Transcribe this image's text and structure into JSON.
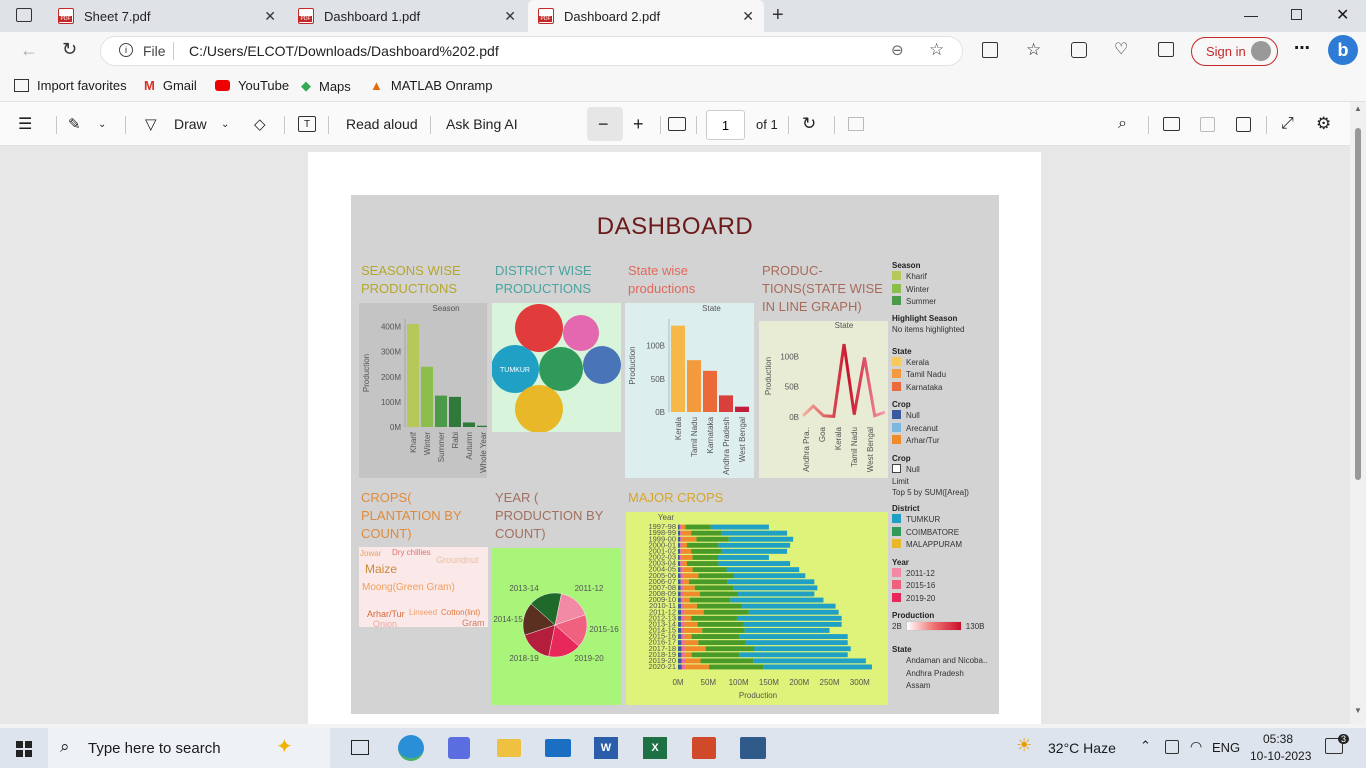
{
  "tabs": [
    {
      "label": "Sheet 7.pdf"
    },
    {
      "label": "Dashboard 1.pdf"
    },
    {
      "label": "Dashboard 2.pdf"
    }
  ],
  "address": {
    "file_label": "File",
    "url": "C:/Users/ELCOT/Downloads/Dashboard%202.pdf",
    "signin": "Sign in"
  },
  "favorites": [
    {
      "label": "Import favorites"
    },
    {
      "label": "Gmail"
    },
    {
      "label": "YouTube"
    },
    {
      "label": "Maps"
    },
    {
      "label": "MATLAB Onramp"
    }
  ],
  "pdf_toolbar": {
    "draw": "Draw",
    "read_aloud": "Read aloud",
    "ask_bing": "Ask Bing AI",
    "page_value": "1",
    "page_total": "of 1"
  },
  "dashboard": {
    "title": "DASHBOARD",
    "colors": {
      "bg": "#d3d3d3",
      "title": "#6b1a1a"
    },
    "sections": {
      "seasons": {
        "title_lines": [
          "SEASONS WISE",
          "PRODUCTIONS"
        ],
        "color": "#b5a62c"
      },
      "district": {
        "title_lines": [
          "DISTRICT WISE",
          "PRODUCTIONS"
        ],
        "color": "#4aa3a0"
      },
      "state": {
        "title_lines": [
          "State wise",
          "productions"
        ],
        "color": "#e0695a"
      },
      "line": {
        "title_lines": [
          "PRODUC-",
          "TIONS(STATE WISE",
          "IN LINE GRAPH)"
        ],
        "color": "#a86b5a"
      },
      "crops": {
        "title_lines": [
          "CROPS(",
          "PLANTATION BY",
          "COUNT)"
        ],
        "color": "#e08b3c"
      },
      "year": {
        "title_lines": [
          "YEAR (",
          "PRODUCTION BY",
          "COUNT)"
        ],
        "color": "#a07060"
      },
      "major": {
        "title_lines": [
          "MAJOR CROPS"
        ],
        "color": "#d6a62a"
      }
    }
  },
  "chart_data": [
    {
      "type": "bar",
      "name": "seasons",
      "header": "Season",
      "ylabel": "Production",
      "categories": [
        "Kharif",
        "Winter",
        "Summer",
        "Rabi",
        "Autumn",
        "Whole Year"
      ],
      "values": [
        410,
        240,
        125,
        120,
        18,
        5
      ],
      "ticks": [
        "400M",
        "300M",
        "200M",
        "100M",
        "0M"
      ],
      "tick_values": [
        400,
        300,
        200,
        100,
        0
      ],
      "ylim": [
        0,
        430
      ],
      "colors": [
        "#b5c95a",
        "#8cbf4a",
        "#4a9a4a",
        "#2f7a3a",
        "#2f7a3a",
        "#2f7a3a"
      ]
    },
    {
      "type": "bubble",
      "name": "district",
      "labels": [
        "",
        "",
        "TUMKUR",
        "",
        "",
        ""
      ],
      "values": [
        1,
        0.7,
        1,
        1,
        0.8,
        1
      ],
      "colors": [
        "#e23b3b",
        "#e468b0",
        "#1fa0c4",
        "#2f9a5a",
        "#4a74b8",
        "#e8b828"
      ]
    },
    {
      "type": "bar",
      "name": "state",
      "header": "State",
      "ylabel": "Production",
      "categories": [
        "Kerala",
        "Tamil Nadu",
        "Karnataka",
        "Andhra Pradesh",
        "West Bengal"
      ],
      "values": [
        130,
        78,
        62,
        25,
        8
      ],
      "ticks": [
        "100B",
        "50B",
        "0B"
      ],
      "tick_values": [
        100,
        50,
        0
      ],
      "ylim": [
        0,
        140
      ],
      "colors": [
        "#f7b84a",
        "#f39a3c",
        "#ec6a3a",
        "#d9403c",
        "#c21e3c"
      ]
    },
    {
      "type": "line",
      "name": "state_line",
      "header": "State",
      "ylabel": "Production",
      "categories": [
        "Andhra Pra..",
        "Goa",
        "Kerala",
        "Tamil Nadu",
        "West Bengal"
      ],
      "values": [
        2,
        18,
        2,
        1,
        120,
        4,
        98,
        2,
        8
      ],
      "ticks": [
        "100B",
        "50B",
        "0B"
      ],
      "tick_values": [
        100,
        50,
        0
      ],
      "ylim": [
        0,
        135
      ]
    },
    {
      "type": "wordcloud",
      "name": "crops",
      "words": [
        {
          "t": "Jowar",
          "c": "#e8a060"
        },
        {
          "t": "Dry chillies",
          "c": "#e07070"
        },
        {
          "t": "Groundnut",
          "c": "#e8c0a0"
        },
        {
          "t": "Maize",
          "c": "#c88a3c"
        },
        {
          "t": "Moong(Green Gram)",
          "c": "#f0a060"
        },
        {
          "t": "Arhar/Tur",
          "c": "#d46a3c"
        },
        {
          "t": "Linseed",
          "c": "#f0a070"
        },
        {
          "t": "Cotton(lint)",
          "c": "#e07a40"
        },
        {
          "t": "Onion",
          "c": "#e8a8a0"
        },
        {
          "t": "Gram",
          "c": "#c88060"
        }
      ]
    },
    {
      "type": "pie",
      "name": "year",
      "labels": [
        "2011-12",
        "2015-16",
        "2019-20",
        "2018-19",
        "2014-15",
        "2013-14"
      ],
      "values": [
        1,
        1,
        1,
        1,
        1,
        1
      ],
      "colors": [
        "#f28aa6",
        "#f0617f",
        "#e8285a",
        "#b41e3c",
        "#5a3020",
        "#1f6a2a"
      ]
    },
    {
      "type": "bar",
      "name": "major",
      "header": "Year",
      "xlabel": "Production",
      "categories": [
        "1997-98",
        "1998-99",
        "1999-00",
        "2000-01",
        "2001-02",
        "2002-03",
        "2003-04",
        "2004-05",
        "2005-06",
        "2006-07",
        "2007-08",
        "2008-09",
        "2009-10",
        "2010-11",
        "2011-12",
        "2012-13",
        "2013-14",
        "2014-15",
        "2015-16",
        "2016-17",
        "2017-18",
        "2018-19",
        "2019-20",
        "2020-21"
      ],
      "values": [
        150,
        180,
        190,
        185,
        180,
        150,
        185,
        200,
        210,
        225,
        230,
        225,
        240,
        260,
        265,
        270,
        270,
        250,
        280,
        280,
        285,
        280,
        310,
        320
      ],
      "ticks": [
        "0M",
        "50M",
        "100M",
        "150M",
        "200M",
        "250M",
        "300M"
      ],
      "tick_values": [
        0,
        50,
        100,
        150,
        200,
        250,
        300
      ],
      "xlim": [
        0,
        330
      ]
    }
  ],
  "legend": [
    {
      "title": "Season",
      "items": [
        {
          "l": "Kharif",
          "c": "#b5c95a"
        },
        {
          "l": "Winter",
          "c": "#8cbf4a"
        },
        {
          "l": "Summer",
          "c": "#4a9a4a"
        }
      ]
    },
    {
      "title": "Highlight Season",
      "note": "No items highlighted"
    },
    {
      "title": "State",
      "items": [
        {
          "l": "Kerala",
          "c": "#f7c85a"
        },
        {
          "l": "Tamil Nadu",
          "c": "#f39a3c"
        },
        {
          "l": "Karnataka",
          "c": "#ec6a3a"
        }
      ]
    },
    {
      "title": "Crop",
      "items": [
        {
          "l": "Null",
          "c": "#3a5aa0"
        },
        {
          "l": "Arecanut",
          "c": "#7ab8e0"
        },
        {
          "l": "Arhar/Tur",
          "c": "#f08a2a"
        }
      ]
    },
    {
      "title": "Crop",
      "items": [
        {
          "l": "Null",
          "c": "#ffffff"
        }
      ],
      "extra": [
        "Limit",
        "Top 5 by SUM([Area])"
      ]
    },
    {
      "title": "District",
      "items": [
        {
          "l": "TUMKUR",
          "c": "#1fa0c4"
        },
        {
          "l": "COIMBATORE",
          "c": "#2f9a5a"
        },
        {
          "l": "MALAPPURAM",
          "c": "#e8b828"
        }
      ]
    },
    {
      "title": "Year",
      "items": [
        {
          "l": "2011-12",
          "c": "#f28aa6"
        },
        {
          "l": "2015-16",
          "c": "#f0617f"
        },
        {
          "l": "2019-20",
          "c": "#e8285a"
        }
      ]
    },
    {
      "title": "Production",
      "range": [
        "2B",
        "130B"
      ]
    },
    {
      "title": "State",
      "items": [
        {
          "l": "Andaman and Nicoba..",
          "c": ""
        },
        {
          "l": "Andhra Pradesh",
          "c": ""
        },
        {
          "l": "Assam",
          "c": ""
        }
      ]
    }
  ],
  "taskbar": {
    "search": "Type here to search",
    "weather": "32°C  Haze",
    "lang": "ENG",
    "time": "05:38",
    "date": "10-10-2023",
    "notif": "3"
  }
}
